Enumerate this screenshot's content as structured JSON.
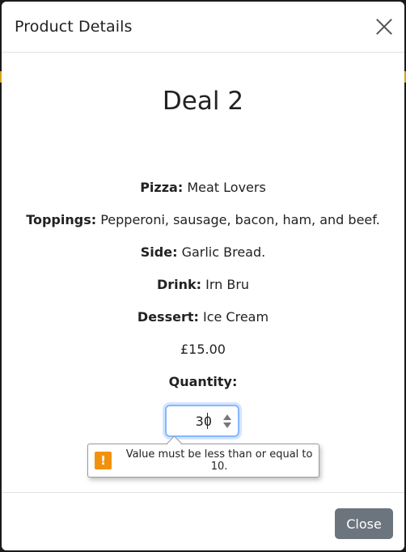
{
  "modal": {
    "title": "Product Details",
    "product_name": "Deal 2",
    "details": [
      {
        "label": "Pizza:",
        "value": "Meat Lovers"
      },
      {
        "label": "Toppings:",
        "value": "Pepperoni, sausage, bacon, ham, and beef."
      },
      {
        "label": "Side:",
        "value": "Garlic Bread."
      },
      {
        "label": "Drink:",
        "value": "Irn Bru"
      },
      {
        "label": "Dessert:",
        "value": "Ice Cream"
      }
    ],
    "price": "£15.00",
    "quantity_label": "Quantity:",
    "quantity_value": "30",
    "validation_message": "Value must be less than or equal to 10.",
    "close_label": "Close"
  },
  "colors": {
    "accent_focus": "#86b7fe",
    "warning": "#f2910d",
    "close_button": "#6c757d"
  },
  "icons": {
    "close": "close-icon",
    "warning": "warning-icon",
    "spinner": "spinner-arrows-icon"
  }
}
